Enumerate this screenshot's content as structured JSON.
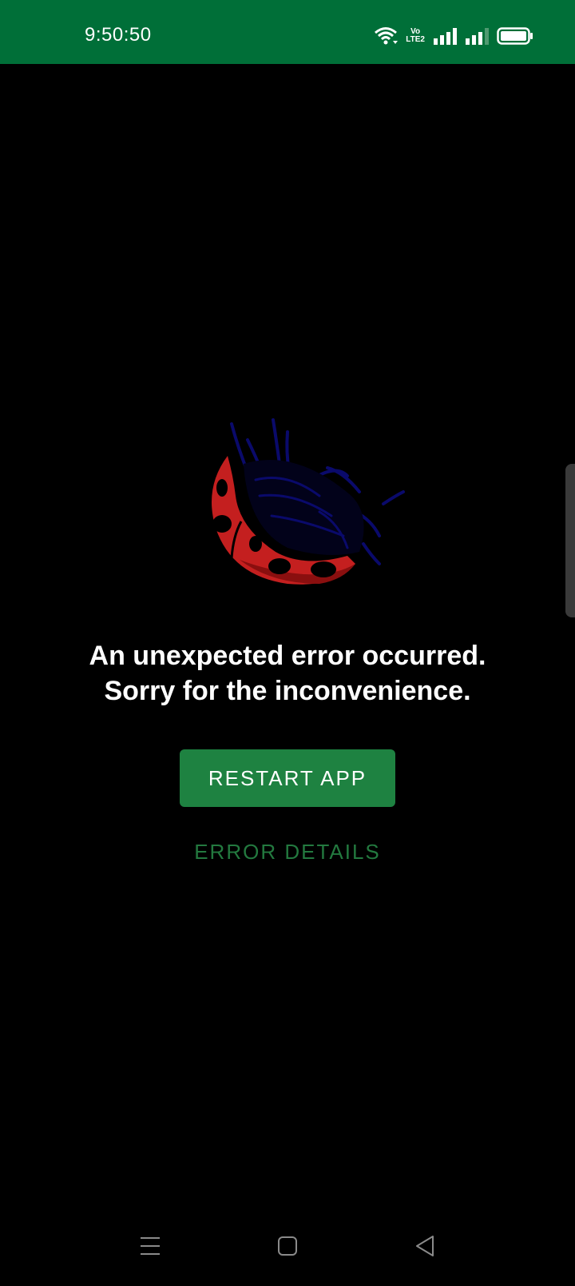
{
  "status_bar": {
    "time": "9:50:50",
    "icons": [
      "wifi-icon",
      "volte-icon",
      "signal-sim1-icon",
      "signal-sim2-icon",
      "battery-icon"
    ],
    "volte_label_top": "Vo",
    "volte_label_bottom": "LTE2",
    "background_color": "#006f38"
  },
  "illustration": {
    "icon": "ladybug-icon"
  },
  "error": {
    "line1": "An unexpected error occurred.",
    "line2": "Sorry for the inconvenience."
  },
  "actions": {
    "restart_label": "RESTART APP",
    "details_label": "ERROR DETAILS",
    "accent_color": "#1e8241"
  },
  "nav_bar": {
    "items": [
      "menu-icon",
      "home-icon",
      "back-icon"
    ]
  }
}
